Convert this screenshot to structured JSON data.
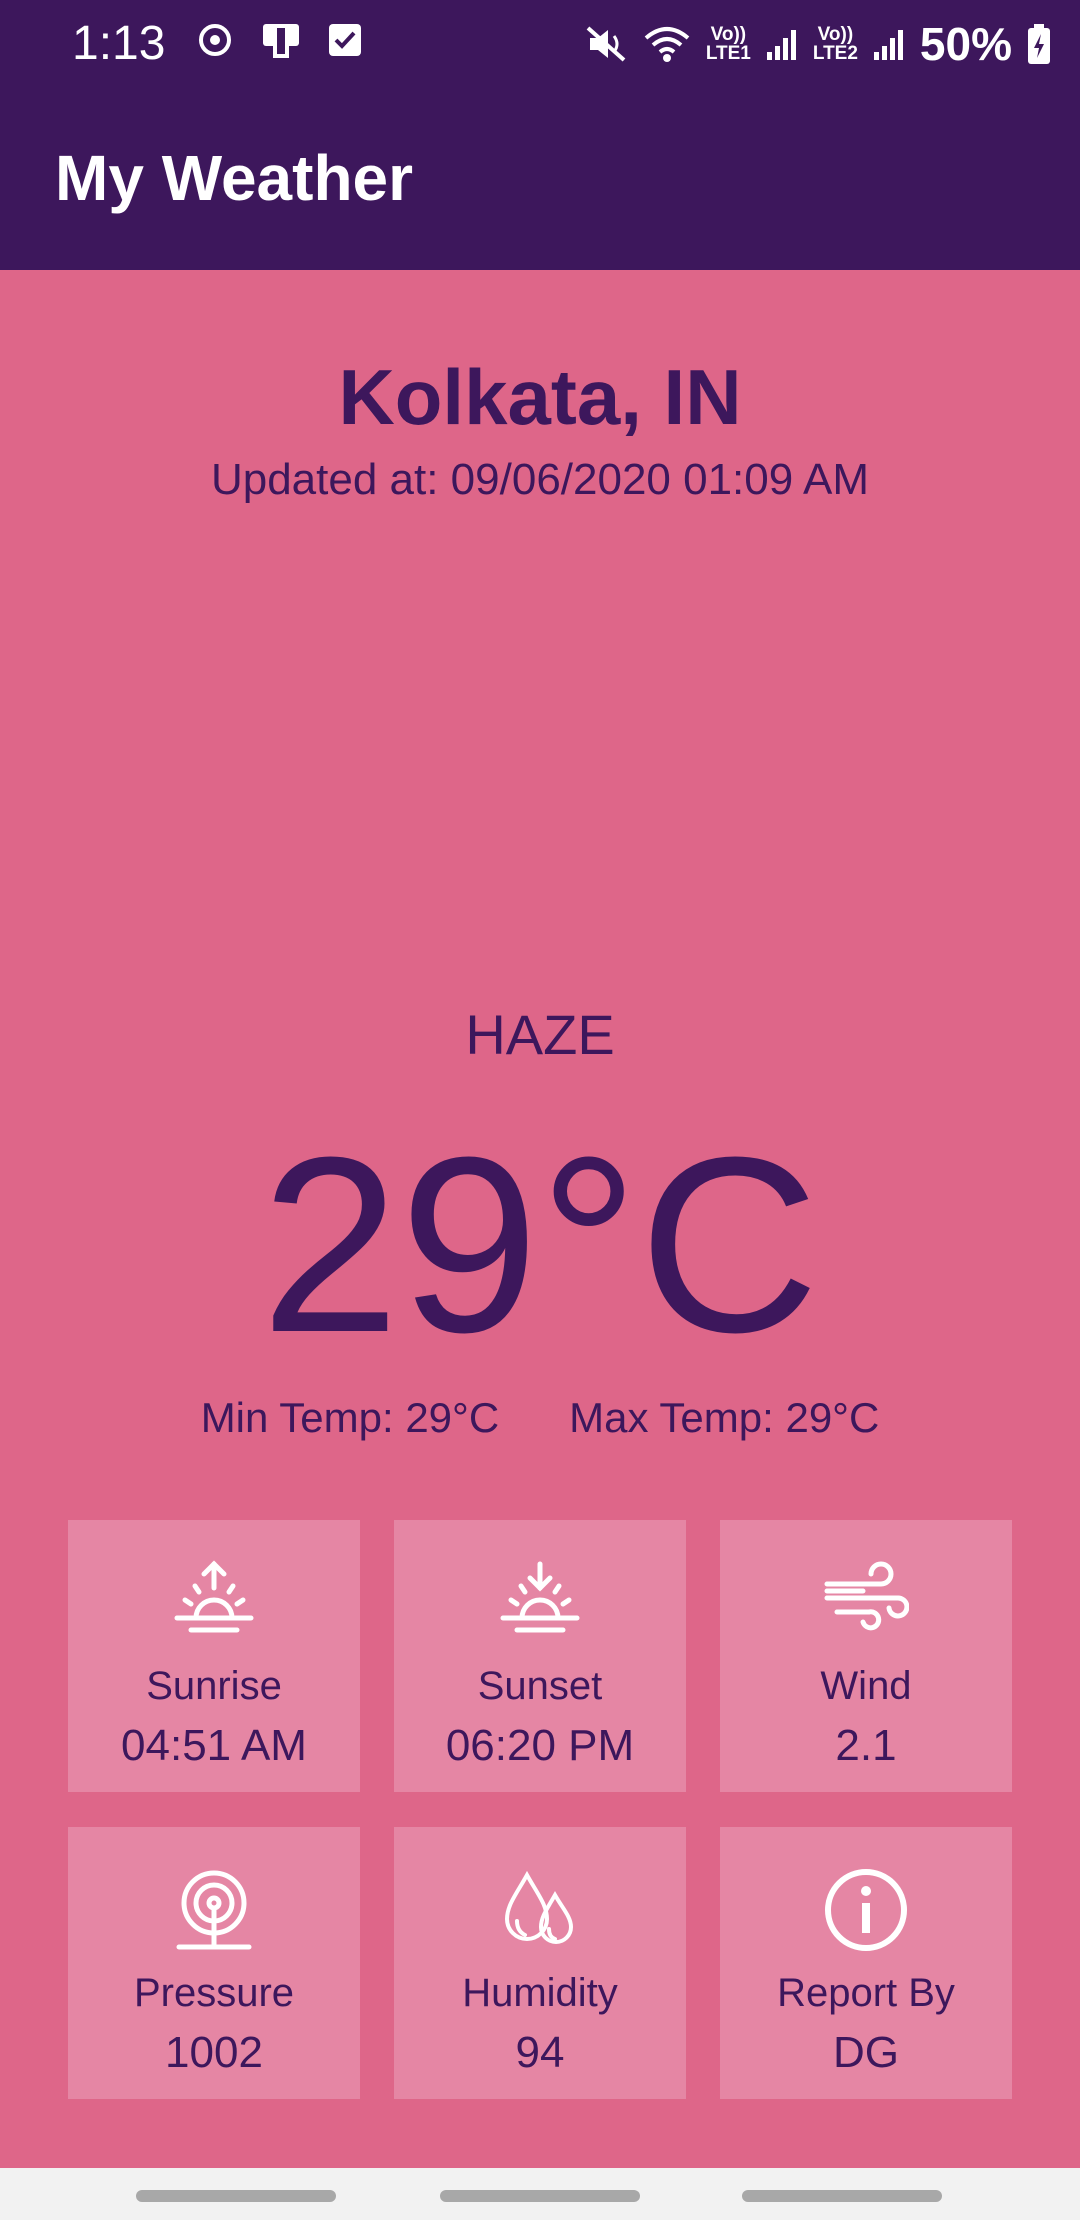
{
  "status_bar": {
    "time": "1:13",
    "network_1": {
      "top": "Vo))",
      "bottom": "LTE1"
    },
    "network_2": {
      "top": "Vo))",
      "bottom": "LTE2"
    },
    "battery": "50%",
    "icons": [
      "sync-icon",
      "cast-icon",
      "checkbox-icon",
      "mute-icon",
      "wifi-icon",
      "signal-icon",
      "battery-charging-icon"
    ]
  },
  "app_bar": {
    "title": "My Weather"
  },
  "location": {
    "city": "Kolkata, IN",
    "updated": "Updated at: 09/06/2020 01:09 AM"
  },
  "weather": {
    "condition": "HAZE",
    "temperature": "29°C",
    "min_temp": "Min Temp: 29°C",
    "max_temp": "Max Temp: 29°C"
  },
  "tiles": [
    {
      "label": "Sunrise",
      "value": "04:51 AM",
      "icon": "sunrise-icon"
    },
    {
      "label": "Sunset",
      "value": "06:20 PM",
      "icon": "sunset-icon"
    },
    {
      "label": "Wind",
      "value": "2.1",
      "icon": "wind-icon"
    },
    {
      "label": "Pressure",
      "value": "1002",
      "icon": "pressure-icon"
    },
    {
      "label": "Humidity",
      "value": "94",
      "icon": "humidity-icon"
    },
    {
      "label": "Report By",
      "value": "DG",
      "icon": "info-icon"
    }
  ],
  "colors": {
    "primary_dark": "#3d175c",
    "background": "#de6689",
    "tile": "#e586a4"
  }
}
